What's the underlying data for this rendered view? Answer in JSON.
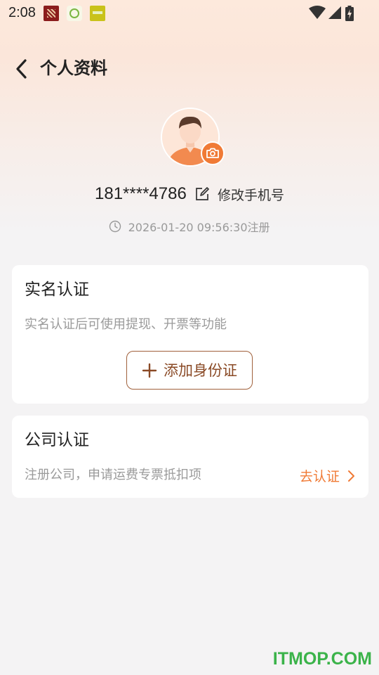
{
  "status_bar": {
    "time": "2:08",
    "notification_icons": [
      "app-notification-icon",
      "app-notification-icon",
      "app-notification-icon"
    ],
    "system_icons": [
      "wifi-icon",
      "signal-icon",
      "battery-charging-icon"
    ]
  },
  "header": {
    "title": "个人资料",
    "back_icon": "chevron-left-icon"
  },
  "profile": {
    "phone": "181****4786",
    "edit_phone_label": "修改手机号",
    "registered": "2026-01-20 09:56:30注册"
  },
  "real_name_card": {
    "title": "实名认证",
    "description": "实名认证后可使用提现、开票等功能",
    "button_label": "添加身份证"
  },
  "company_card": {
    "title": "公司认证",
    "description": "注册公司，申请运费专票抵扣项",
    "action_label": "去认证"
  },
  "watermark": "ITMOP.COM",
  "colors": {
    "accent": "#f07a35",
    "button_border": "#a0603b",
    "button_text": "#8a4a26",
    "watermark": "#3bb34a"
  }
}
